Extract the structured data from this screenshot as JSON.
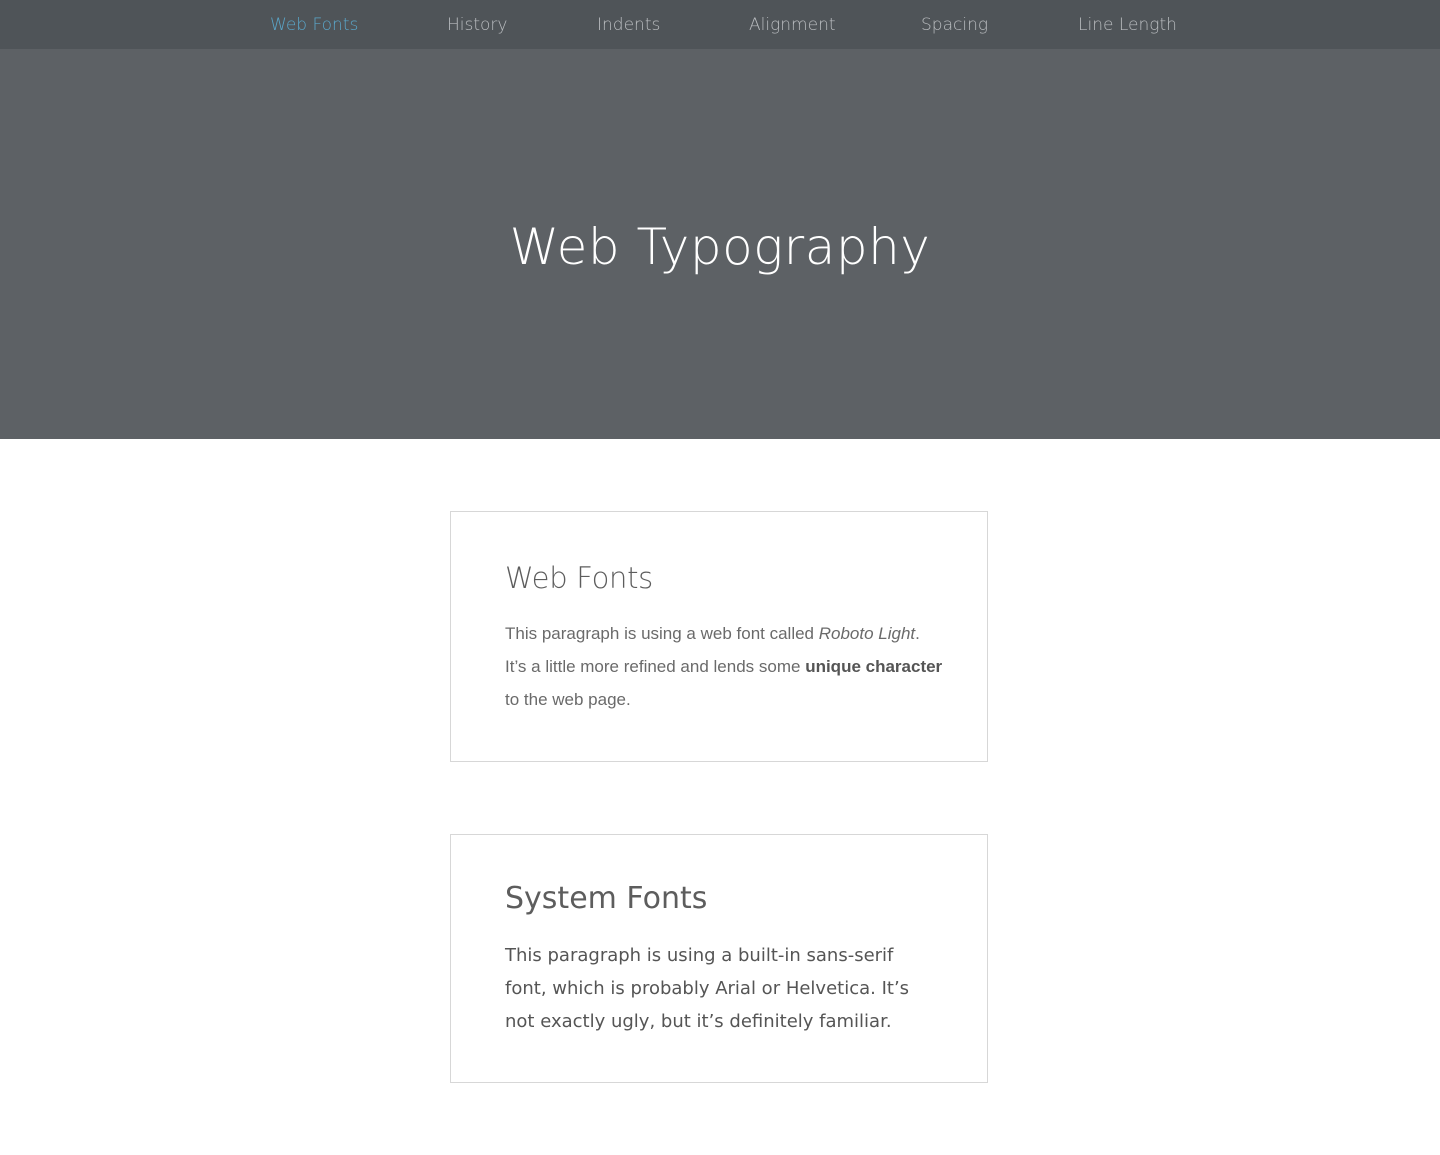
{
  "nav": {
    "items": [
      {
        "label": "Web Fonts",
        "active": true
      },
      {
        "label": "History",
        "active": false
      },
      {
        "label": "Indents",
        "active": false
      },
      {
        "label": "Alignment",
        "active": false
      },
      {
        "label": "Spacing",
        "active": false
      },
      {
        "label": "Line Length",
        "active": false
      }
    ]
  },
  "hero": {
    "title": "Web Typography"
  },
  "web_fonts_card": {
    "heading": "Web Fonts",
    "text_1": "This paragraph is using a web font called ",
    "font_name": "Roboto Light",
    "text_2": ". It’s a little more refined and lends some ",
    "emphasis": "unique character",
    "text_3": " to the web page."
  },
  "system_fonts_card": {
    "heading": "System Fonts",
    "text": "This paragraph is using a built-in sans-serif font, which is probably Arial or Helvetica. It’s not exactly ugly, but it’s definitely familiar."
  },
  "colors": {
    "nav_background": "#4f5458",
    "hero_background": "#5d6165",
    "active_link": "#5aa6c9",
    "inactive_link": "#b9bcbf",
    "card_border": "#d7d7d7",
    "body_text": "#5d5d5d"
  }
}
